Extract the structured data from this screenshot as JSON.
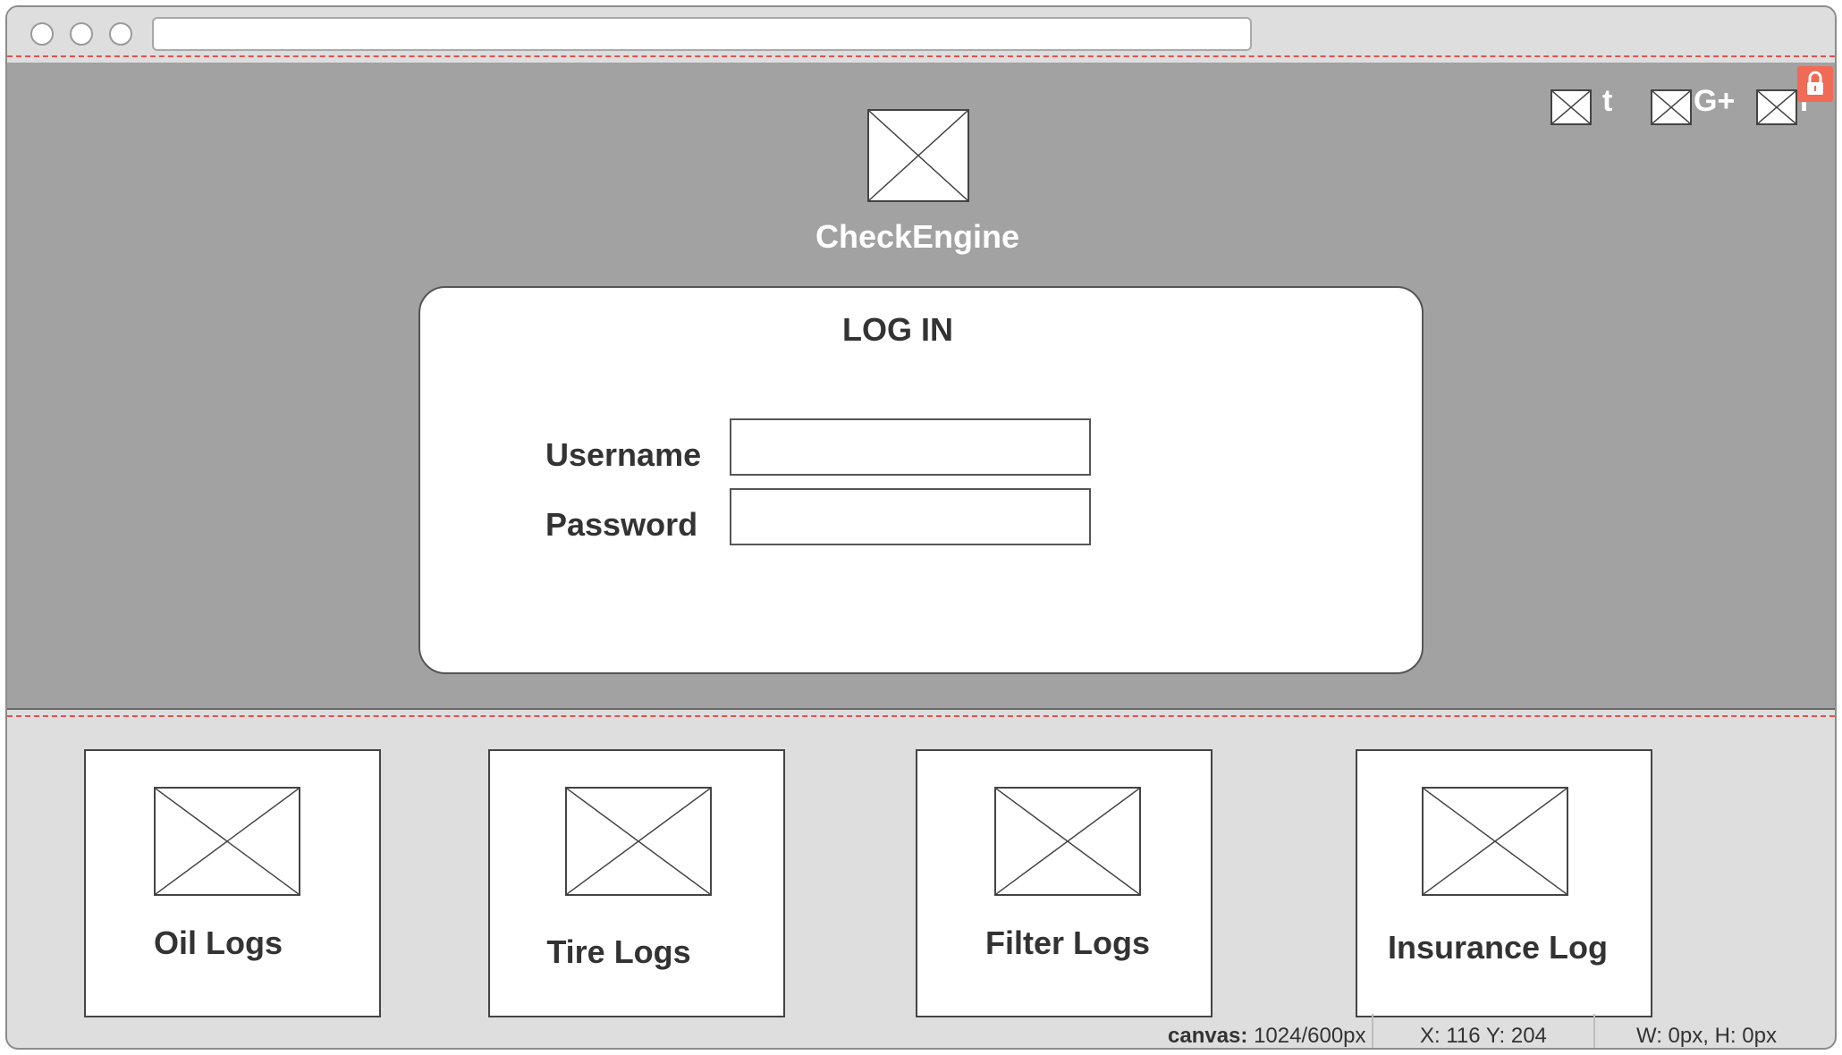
{
  "browser": {
    "url": ""
  },
  "header": {
    "brand": "CheckEngine",
    "social": [
      {
        "icon": "twitter-placeholder-icon",
        "label": "t"
      },
      {
        "icon": "google-plus-placeholder-icon",
        "label": "G+"
      },
      {
        "icon": "facebook-placeholder-icon",
        "label": "f"
      }
    ]
  },
  "login": {
    "title": "LOG IN",
    "username_label": "Username",
    "password_label": "Password",
    "username_value": "",
    "password_value": ""
  },
  "cards": [
    {
      "label": "Oil Logs"
    },
    {
      "label": "Tire Logs"
    },
    {
      "label": "Filter Logs"
    },
    {
      "label": "Insurance Log"
    }
  ],
  "status": {
    "canvas_key": "canvas:",
    "canvas_val": "1024/600px",
    "coords": "X: 116 Y: 204",
    "size": "W: 0px, H: 0px"
  },
  "colors": {
    "hero_bg": "#a2a2a2",
    "lock_badge": "#f06a55",
    "guide_line": "#e0524c"
  }
}
